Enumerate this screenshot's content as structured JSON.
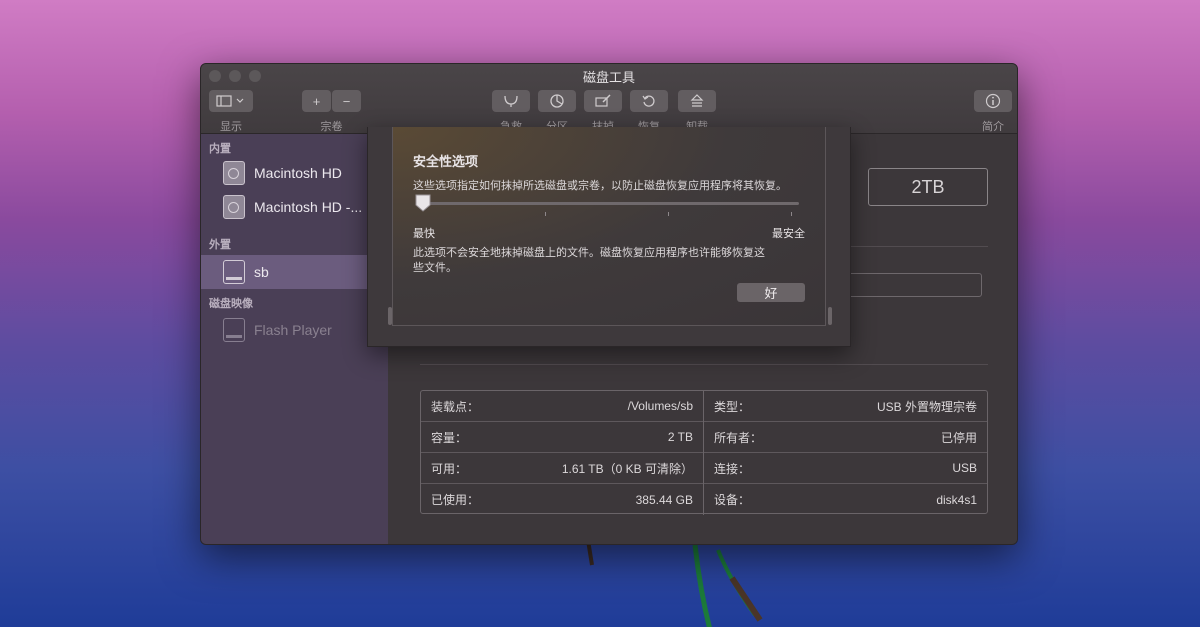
{
  "window": {
    "title": "磁盘工具"
  },
  "toolbar": {
    "view_label": "显示",
    "volume_label": "宗卷",
    "add_symbol": "+",
    "remove_symbol": "−",
    "firstaid_label": "急救",
    "partition_label": "分区",
    "erase_label": "抹掉",
    "restore_label": "恢复",
    "unmount_label": "卸载",
    "info_label": "简介"
  },
  "sidebar": {
    "internal_heading": "内置",
    "internal_items": [
      {
        "label": "Macintosh HD",
        "icon": "internal-disk-icon"
      },
      {
        "label": "Macintosh HD -...",
        "icon": "internal-disk-icon"
      }
    ],
    "external_heading": "外置",
    "external_items": [
      {
        "label": "sb",
        "icon": "external-disk-icon",
        "selected": true
      }
    ],
    "images_heading": "磁盘映像",
    "image_items": [
      {
        "label": "Flash Player",
        "icon": "disk-image-icon",
        "dimmed": true
      }
    ]
  },
  "content": {
    "capacity_badge": "2TB"
  },
  "info": {
    "left": [
      {
        "key": "装载点：",
        "value": "/Volumes/sb"
      },
      {
        "key": "容量：",
        "value": "2 TB"
      },
      {
        "key": "可用：",
        "value": "1.61 TB（0 KB 可清除）"
      },
      {
        "key": "已使用：",
        "value": "385.44 GB"
      }
    ],
    "right": [
      {
        "key": "类型：",
        "value": "USB 外置物理宗卷"
      },
      {
        "key": "所有者：",
        "value": "已停用"
      },
      {
        "key": "连接：",
        "value": "USB"
      },
      {
        "key": "设备：",
        "value": "disk4s1"
      }
    ]
  },
  "security_popover": {
    "title": "安全性选项",
    "description": "这些选项指定如何抹掉所选磁盘或宗卷，以防止磁盘恢复应用程序将其恢复。",
    "slider_level": 0,
    "label_fastest": "最快",
    "label_most_secure": "最安全",
    "note": "此选项不会安全地抹掉磁盘上的文件。磁盘恢复应用程序也许能够恢复这些文件。",
    "ok_label": "好"
  },
  "colors": {
    "sidebar_bg": "#4a3f56",
    "selection": "#6b5c7e",
    "window_bg": "#3b3639"
  }
}
